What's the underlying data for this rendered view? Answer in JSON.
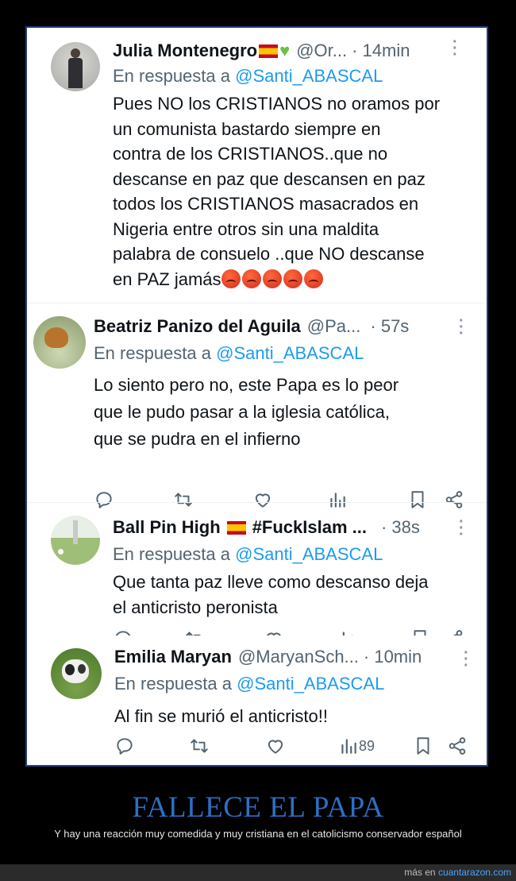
{
  "tweets": [
    {
      "name": "Julia Montenegro",
      "handle": "@Or...",
      "time": "· 14min",
      "reply_label": "En respuesta a",
      "reply_mention": "@Santi_ABASCAL",
      "lines": [
        "Pues NO los CRISTIANOS no oramos por",
        "un comunista bastardo siempre en",
        "contra de los CRISTIANOS..que no",
        "descanse en paz que descansen en paz",
        "todos los CRISTIANOS masacrados en",
        "Nigeria entre otros sin una maldita",
        "palabra de consuelo ..que NO descanse",
        "en PAZ jamás"
      ],
      "emojis": [
        "flag-spain",
        "green-heart",
        "angry-face x5"
      ]
    },
    {
      "name": "Beatriz Panizo del Aguila",
      "handle": "@Pa...",
      "time": "· 57s",
      "reply_label": "En respuesta a",
      "reply_mention": "@Santi_ABASCAL",
      "lines": [
        "Lo siento pero no, este Papa es lo peor",
        "que le pudo pasar a la iglesia católica,",
        "que se pudra en el infierno"
      ]
    },
    {
      "name": "Ball Pin High",
      "name_suffix": "#FuckIslam ...",
      "handle": "",
      "time": "· 38s",
      "reply_label": "En respuesta a",
      "reply_mention": "@Santi_ABASCAL",
      "lines": [
        "Que tanta paz lleve como descanso deja",
        "el anticristo peronista"
      ]
    },
    {
      "name": "Emilia Maryan",
      "handle": "@MaryanSch...",
      "time": "· 10min",
      "reply_label": "En respuesta a",
      "reply_mention": "@Santi_ABASCAL",
      "lines": [
        "Al fin se murió el anticristo!!"
      ],
      "views": "89"
    }
  ],
  "footer": {
    "title": "FALLECE EL PAPA",
    "subtitle": "Y hay una reacción muy comedida y muy cristiana en el catolicismo conservador español",
    "credit_prefix": "más en",
    "credit_site": "cuantarazon.com"
  },
  "colors": {
    "link": "#1d9bf0",
    "muted": "#536471",
    "frame_border": "#1f3f8a",
    "footer_title": "#2d6fc4"
  },
  "icons": [
    "more-icon",
    "reply-icon",
    "retweet-icon",
    "like-icon",
    "views-icon",
    "bookmark-icon",
    "share-icon"
  ]
}
